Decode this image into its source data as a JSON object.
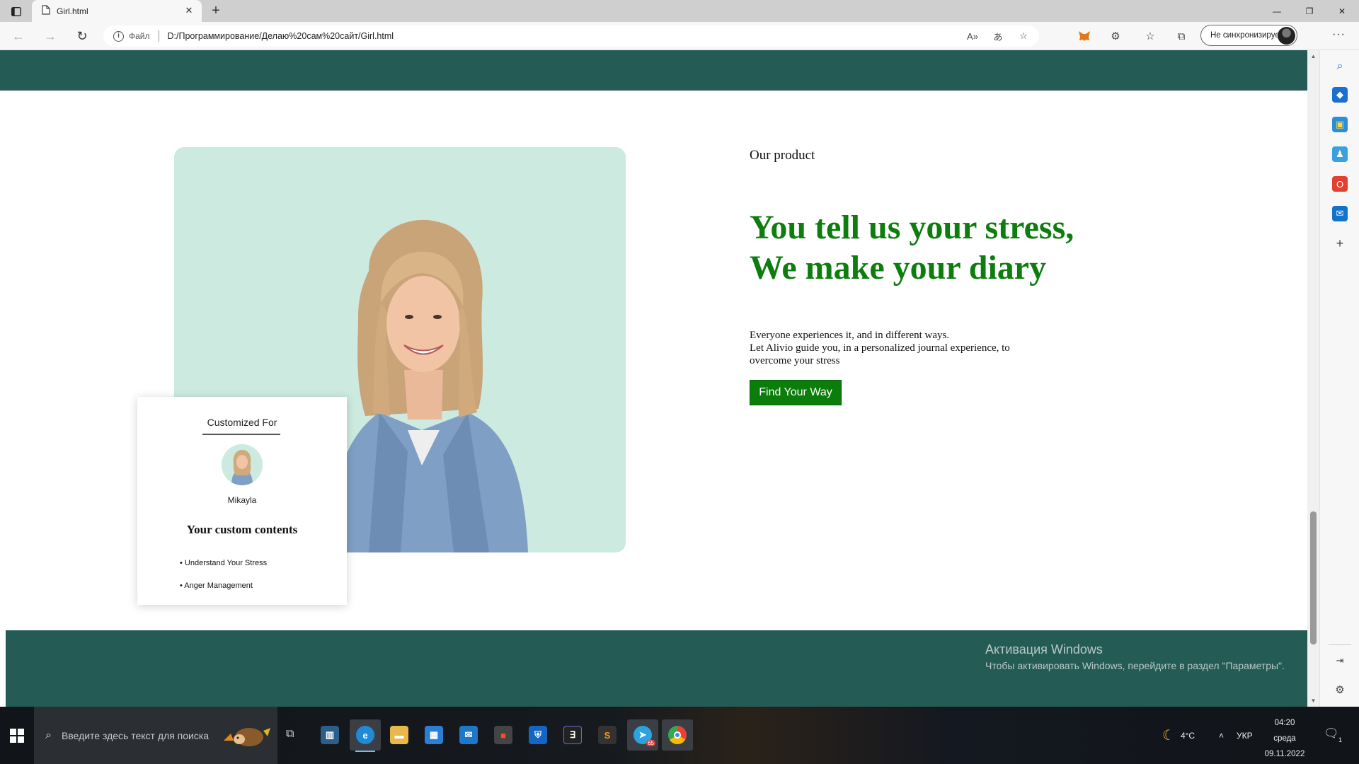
{
  "browser": {
    "tab": {
      "title": "Girl.html"
    },
    "address": {
      "scheme_label": "Файл",
      "url": "D:/Программирование/Делаю%20сам%20сайт/Girl.html"
    },
    "sync_label": "Не синхронизируется"
  },
  "page": {
    "section_label": "Our product",
    "headline_line1": "You tell us your stress,",
    "headline_line2": "We make your diary",
    "description_line1": "Everyone experiences it, and in different ways.",
    "description_line2": "Let Alivio guide you, in a personalized journal experience, to overcome your stress",
    "cta_label": "Find Your Way",
    "card": {
      "title": "Customized For",
      "name": "Mikayla",
      "heading": "Your custom contents",
      "items": [
        "• Understand Your Stress",
        "• Anger Management"
      ]
    }
  },
  "activation": {
    "title": "Активация Windows",
    "subtitle": "Чтобы активировать Windows, перейдите в раздел \"Параметры\"."
  },
  "taskbar": {
    "search_placeholder": "Введите здесь текст для поиска",
    "weather": "4°C",
    "language": "УКР",
    "time": "04:20",
    "day": "среда",
    "date": "09.11.2022",
    "telegram_badge": "65",
    "notification_count": "1"
  },
  "colors": {
    "band": "#245b55",
    "hero_bg": "#cdeae0",
    "headline": "#0d7d0d",
    "cta_bg": "#0a7d0a"
  }
}
